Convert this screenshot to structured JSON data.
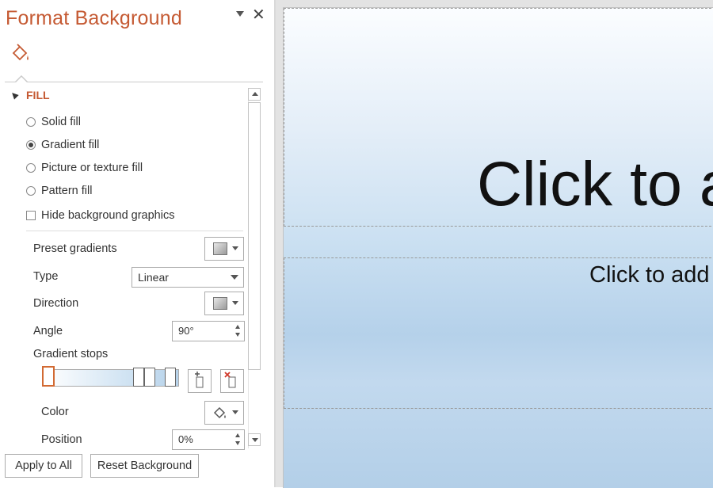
{
  "pane": {
    "title": "Format Background",
    "close_glyph": "✕",
    "section_title": "FILL",
    "fill_options": [
      {
        "label": "Solid fill",
        "selected": false
      },
      {
        "label": "Gradient fill",
        "selected": true
      },
      {
        "label": "Picture or texture fill",
        "selected": false
      },
      {
        "label": "Pattern fill",
        "selected": false
      }
    ],
    "hide_graphics_label": "Hide background graphics",
    "preset_label": "Preset gradients",
    "type_label": "Type",
    "type_value": "Linear",
    "direction_label": "Direction",
    "angle_label": "Angle",
    "angle_value": "90°",
    "stops_label": "Gradient stops",
    "color_label": "Color",
    "position_label": "Position",
    "position_value": "0%",
    "apply_all": "Apply to All",
    "reset": "Reset Background"
  },
  "slide": {
    "title_text": "Click to a",
    "subtitle_text": "Click to add"
  },
  "colors": {
    "accent": "#c55a33",
    "slide_gradient_top": "#fbfdff",
    "slide_gradient_mid": "#c9dff1",
    "slide_gradient_bottom": "#b3cfe8"
  }
}
